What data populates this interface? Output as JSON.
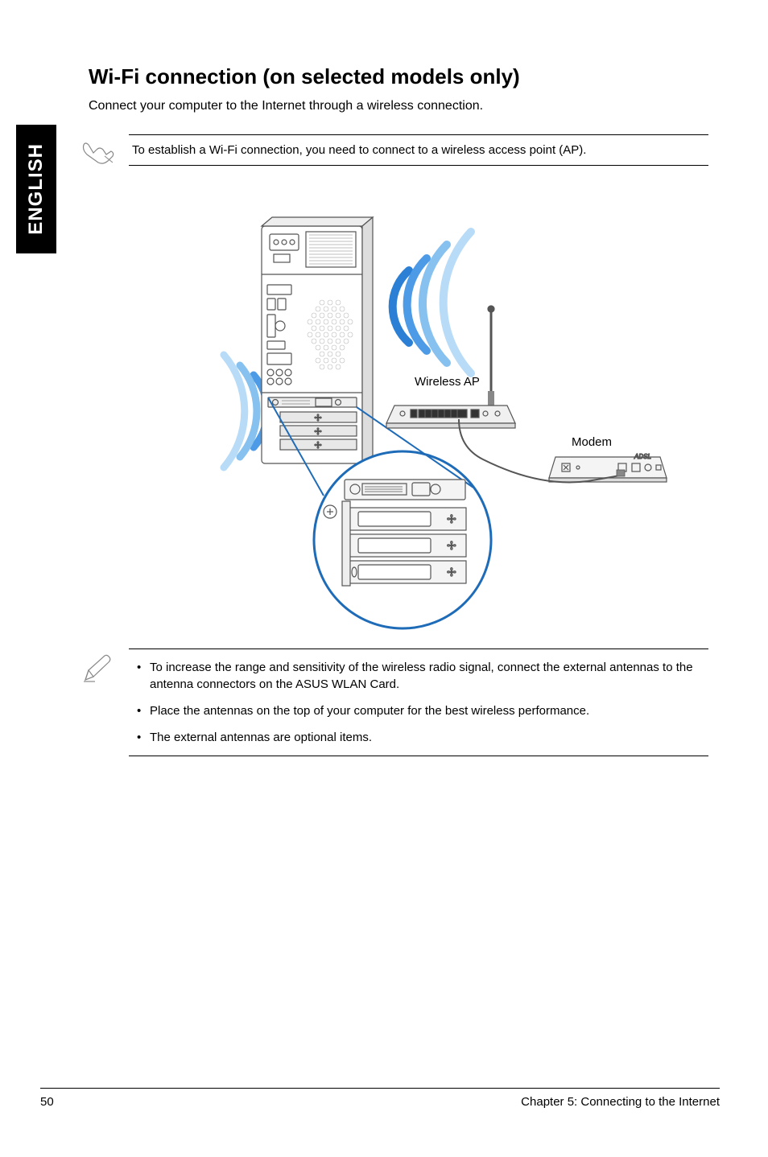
{
  "language_tab": "ENGLISH",
  "heading": "Wi-Fi connection (on selected models only)",
  "intro": "Connect your computer to the Internet through a wireless connection.",
  "note1": "To establish a Wi-Fi connection, you need to connect to a wireless access point (AP).",
  "diagram": {
    "wireless_ap_label": "Wireless AP",
    "modem_label": "Modem",
    "modem_text": "ADSL"
  },
  "notes": {
    "item1": "To increase the range and sensitivity of the wireless radio signal, connect the external antennas to the antenna connectors on the ASUS WLAN Card.",
    "item2": "Place the antennas on the top of your computer for the best wireless performance.",
    "item3": "The external antennas are optional items."
  },
  "footer": {
    "page": "50",
    "chapter": "Chapter 5: Connecting to the Internet"
  }
}
